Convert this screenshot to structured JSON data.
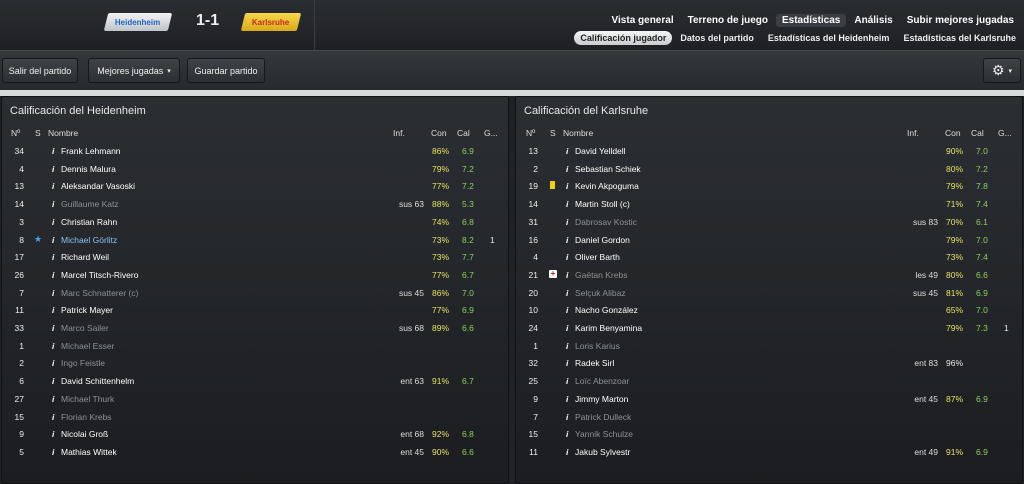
{
  "match": {
    "home_team": "Heidenheim",
    "away_team": "Karlsruhe",
    "score": "1-1"
  },
  "main_tabs": [
    "Vista general",
    "Terreno de juego",
    "Estadísticas",
    "Análisis",
    "Subir mejores jugadas"
  ],
  "main_tab_active": "Estadísticas",
  "sub_tabs": [
    "Calificación jugador",
    "Datos del partido",
    "Estadísticas del Heidenheim",
    "Estadísticas del Karlsruhe"
  ],
  "sub_tab_active": "Calificación jugador",
  "toolbar": {
    "exit_label": "Salir del partido",
    "best_label": "Mejores jugadas",
    "save_label": "Guardar partido"
  },
  "columns": {
    "num": "Nº",
    "s": "S",
    "name": "Nombre",
    "inf": "Inf.",
    "con": "Con",
    "cal": "Cal",
    "gol": "G..."
  },
  "home": {
    "title": "Calificación del Heidenheim",
    "players": [
      {
        "num": "34",
        "name": "Frank Lehmann",
        "inf": "",
        "con": "86%",
        "cal": "6.9",
        "gol": "",
        "dim": false
      },
      {
        "num": "4",
        "name": "Dennis Malura",
        "inf": "",
        "con": "79%",
        "cal": "7.2",
        "gol": "",
        "dim": false
      },
      {
        "num": "13",
        "name": "Aleksandar Vasoski",
        "inf": "",
        "con": "77%",
        "cal": "7.2",
        "gol": "",
        "dim": false
      },
      {
        "num": "14",
        "name": "Guillaume Katz",
        "inf": "sus 63",
        "con": "88%",
        "cal": "5.3",
        "gol": "",
        "dim": true
      },
      {
        "num": "3",
        "name": "Christian Rahn",
        "inf": "",
        "con": "74%",
        "cal": "6.8",
        "gol": "",
        "dim": false
      },
      {
        "num": "8",
        "name": "Michael Görlitz",
        "inf": "",
        "con": "73%",
        "cal": "8.2",
        "gol": "1",
        "dim": false,
        "star": true
      },
      {
        "num": "17",
        "name": "Richard Weil",
        "inf": "",
        "con": "73%",
        "cal": "7.7",
        "gol": "",
        "dim": false
      },
      {
        "num": "26",
        "name": "Marcel Titsch-Rivero",
        "inf": "",
        "con": "77%",
        "cal": "6.7",
        "gol": "",
        "dim": false
      },
      {
        "num": "7",
        "name": "Marc Schnatterer (c)",
        "inf": "sus 45",
        "con": "86%",
        "cal": "7.0",
        "gol": "",
        "dim": true
      },
      {
        "num": "11",
        "name": "Patrick Mayer",
        "inf": "",
        "con": "77%",
        "cal": "6.9",
        "gol": "",
        "dim": false
      },
      {
        "num": "33",
        "name": "Marco Sailer",
        "inf": "sus 68",
        "con": "89%",
        "cal": "6.6",
        "gol": "",
        "dim": true
      },
      {
        "num": "1",
        "name": "Michael Esser",
        "inf": "",
        "con": "",
        "cal": "",
        "gol": "",
        "dim": true
      },
      {
        "num": "2",
        "name": "Ingo Feistle",
        "inf": "",
        "con": "",
        "cal": "",
        "gol": "",
        "dim": true
      },
      {
        "num": "6",
        "name": "David Schittenhelm",
        "inf": "ent 63",
        "con": "91%",
        "cal": "6.7",
        "gol": "",
        "dim": false
      },
      {
        "num": "27",
        "name": "Michael Thurk",
        "inf": "",
        "con": "",
        "cal": "",
        "gol": "",
        "dim": true
      },
      {
        "num": "15",
        "name": "Florian Krebs",
        "inf": "",
        "con": "",
        "cal": "",
        "gol": "",
        "dim": true
      },
      {
        "num": "9",
        "name": "Nicolai Groß",
        "inf": "ent 68",
        "con": "92%",
        "cal": "6.8",
        "gol": "",
        "dim": false
      },
      {
        "num": "5",
        "name": "Mathias Wittek",
        "inf": "ent 45",
        "con": "90%",
        "cal": "6.6",
        "gol": "",
        "dim": false
      }
    ]
  },
  "away": {
    "title": "Calificación del Karlsruhe",
    "players": [
      {
        "num": "13",
        "name": "David Yelldell",
        "inf": "",
        "con": "90%",
        "cal": "7.0",
        "gol": "",
        "dim": false
      },
      {
        "num": "2",
        "name": "Sebastian Schiek",
        "inf": "",
        "con": "80%",
        "cal": "7.2",
        "gol": "",
        "dim": false
      },
      {
        "num": "19",
        "name": "Kevin Akpoguma",
        "inf": "",
        "con": "79%",
        "cal": "7.8",
        "gol": "",
        "dim": false,
        "card": "yellow"
      },
      {
        "num": "14",
        "name": "Martin Stoll (c)",
        "inf": "",
        "con": "71%",
        "cal": "7.4",
        "gol": "",
        "dim": false
      },
      {
        "num": "31",
        "name": "Dabrosav Kostic",
        "inf": "sus 83",
        "con": "70%",
        "cal": "6.1",
        "gol": "",
        "dim": true
      },
      {
        "num": "16",
        "name": "Daniel Gordon",
        "inf": "",
        "con": "79%",
        "cal": "7.0",
        "gol": "",
        "dim": false
      },
      {
        "num": "4",
        "name": "Oliver Barth",
        "inf": "",
        "con": "73%",
        "cal": "7.4",
        "gol": "",
        "dim": false
      },
      {
        "num": "21",
        "name": "Gaëtan Krebs",
        "inf": "les 49",
        "con": "80%",
        "cal": "6.6",
        "gol": "",
        "dim": true,
        "injury": true
      },
      {
        "num": "20",
        "name": "Selçuk Alibaz",
        "inf": "sus 45",
        "con": "81%",
        "cal": "6.9",
        "gol": "",
        "dim": true
      },
      {
        "num": "10",
        "name": "Nacho González",
        "inf": "",
        "con": "65%",
        "cal": "7.0",
        "gol": "",
        "dim": false
      },
      {
        "num": "24",
        "name": "Karim Benyamina",
        "inf": "",
        "con": "79%",
        "cal": "7.3",
        "gol": "1",
        "dim": false
      },
      {
        "num": "1",
        "name": "Loris Karius",
        "inf": "",
        "con": "",
        "cal": "",
        "gol": "",
        "dim": true
      },
      {
        "num": "32",
        "name": "Radek Sirl",
        "inf": "ent 83",
        "con": "96%",
        "cal": "",
        "gol": "",
        "dim": false,
        "con_white": true
      },
      {
        "num": "25",
        "name": "Loïc Abenzoar",
        "inf": "",
        "con": "",
        "cal": "",
        "gol": "",
        "dim": true
      },
      {
        "num": "9",
        "name": "Jimmy Marton",
        "inf": "ent 45",
        "con": "87%",
        "cal": "6.9",
        "gol": "",
        "dim": false
      },
      {
        "num": "7",
        "name": "Patrick Dulleck",
        "inf": "",
        "con": "",
        "cal": "",
        "gol": "",
        "dim": true
      },
      {
        "num": "15",
        "name": "Yannik Schulze",
        "inf": "",
        "con": "",
        "cal": "",
        "gol": "",
        "dim": true
      },
      {
        "num": "11",
        "name": "Jakub Sylvestr",
        "inf": "ent 49",
        "con": "91%",
        "cal": "6.9",
        "gol": "",
        "dim": false
      }
    ]
  },
  "icons": {
    "info": "i",
    "gear": "⚙",
    "caret": "▾",
    "star": "★"
  },
  "colors": {
    "home_badge_text": "#2266c4",
    "away_badge_bg": "#f6d84a",
    "away_badge_text": "#d0261b",
    "con_color": "#e6e35a",
    "cal_color": "#8fd05a",
    "dim_text": "#8e9296",
    "star_text": "#8ec0ef"
  }
}
